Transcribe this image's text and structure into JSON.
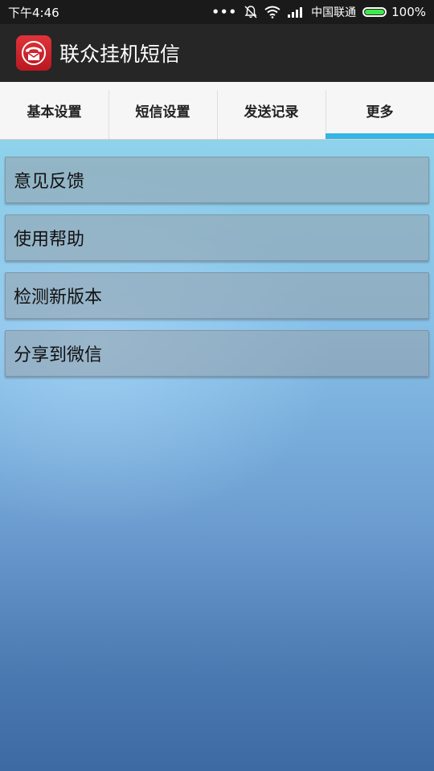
{
  "status_bar": {
    "time": "下午4:46",
    "carrier": "中国联通",
    "battery_percent": "100%",
    "battery_level": 1.0,
    "icons": [
      "more-dots-icon",
      "bell-muted-icon",
      "wifi-icon",
      "signal-icon",
      "battery-icon"
    ]
  },
  "action_bar": {
    "app_icon": "phone-envelope-icon",
    "title": "联众挂机短信"
  },
  "tabs": [
    {
      "label": "基本设置",
      "active": false
    },
    {
      "label": "短信设置",
      "active": false
    },
    {
      "label": "发送记录",
      "active": false
    },
    {
      "label": "更多",
      "active": true
    }
  ],
  "menu": {
    "items": [
      {
        "label": "意见反馈"
      },
      {
        "label": "使用帮助"
      },
      {
        "label": "检测新版本"
      },
      {
        "label": "分享到微信"
      }
    ]
  },
  "colors": {
    "accent": "#33b5e5",
    "app_icon": "#d3272e",
    "battery": "#3fe84a"
  }
}
